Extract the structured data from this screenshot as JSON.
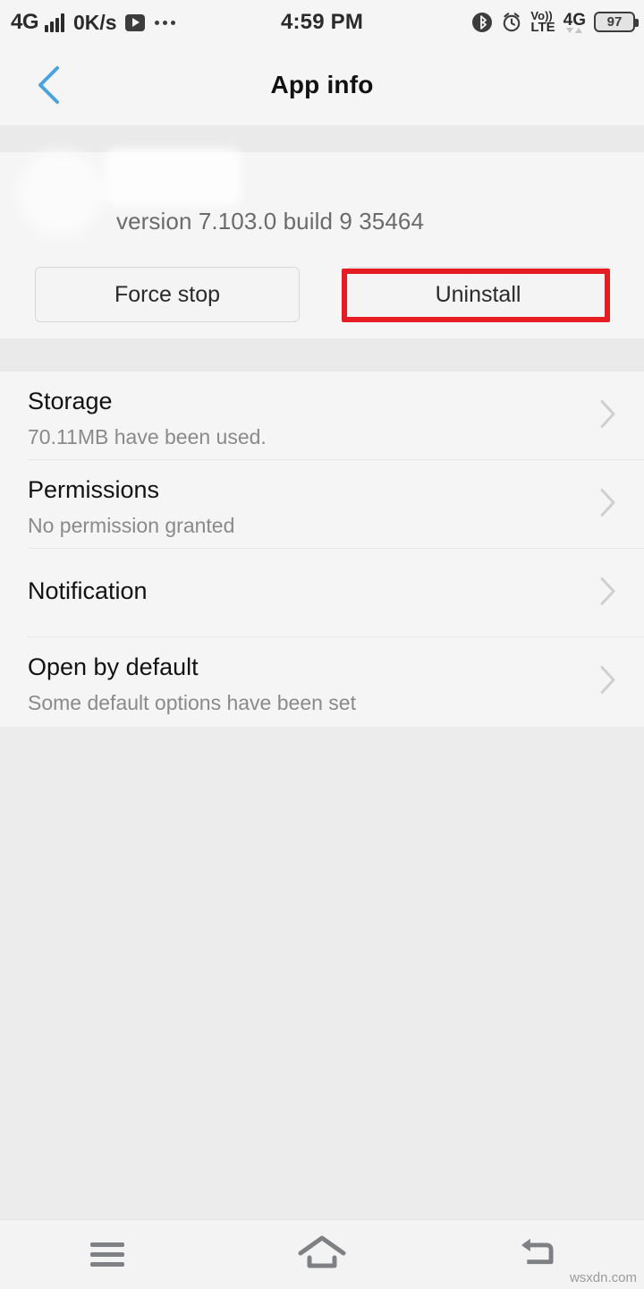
{
  "status_bar": {
    "network_type": "4G",
    "data_speed": "0K/s",
    "media_icon": "play-icon",
    "overflow_icon": "more-dots-icon",
    "clock": "4:59 PM",
    "bluetooth_icon": "bluetooth-icon",
    "alarm_icon": "alarm-clock-icon",
    "volte_line1": "Vo))",
    "volte_line2": "LTE",
    "network_type_right": "4G",
    "battery_level": "97"
  },
  "title_bar": {
    "back_icon": "chevron-left-icon",
    "title": "App info",
    "back_color": "#4aa3df"
  },
  "app_header": {
    "icon": "app-icon-redacted",
    "name": "",
    "version": "version 7.103.0 build 9 35464"
  },
  "actions": {
    "force_stop_label": "Force stop",
    "uninstall_label": "Uninstall",
    "highlight_color": "#e51c23",
    "highlighted": "uninstall"
  },
  "settings_list": [
    {
      "title": "Storage",
      "subtitle": "70.11MB have been used.",
      "chevron": "chevron-right-icon"
    },
    {
      "title": "Permissions",
      "subtitle": "No permission granted",
      "chevron": "chevron-right-icon"
    },
    {
      "title": "Notification",
      "subtitle": "",
      "chevron": "chevron-right-icon"
    },
    {
      "title": "Open by default",
      "subtitle": "Some default options have been set",
      "chevron": "chevron-right-icon"
    }
  ],
  "nav_bar": {
    "menu_icon": "menu-icon",
    "home_icon": "home-icon",
    "back_icon": "back-arrow-icon"
  },
  "watermark": "wsxdn.com"
}
